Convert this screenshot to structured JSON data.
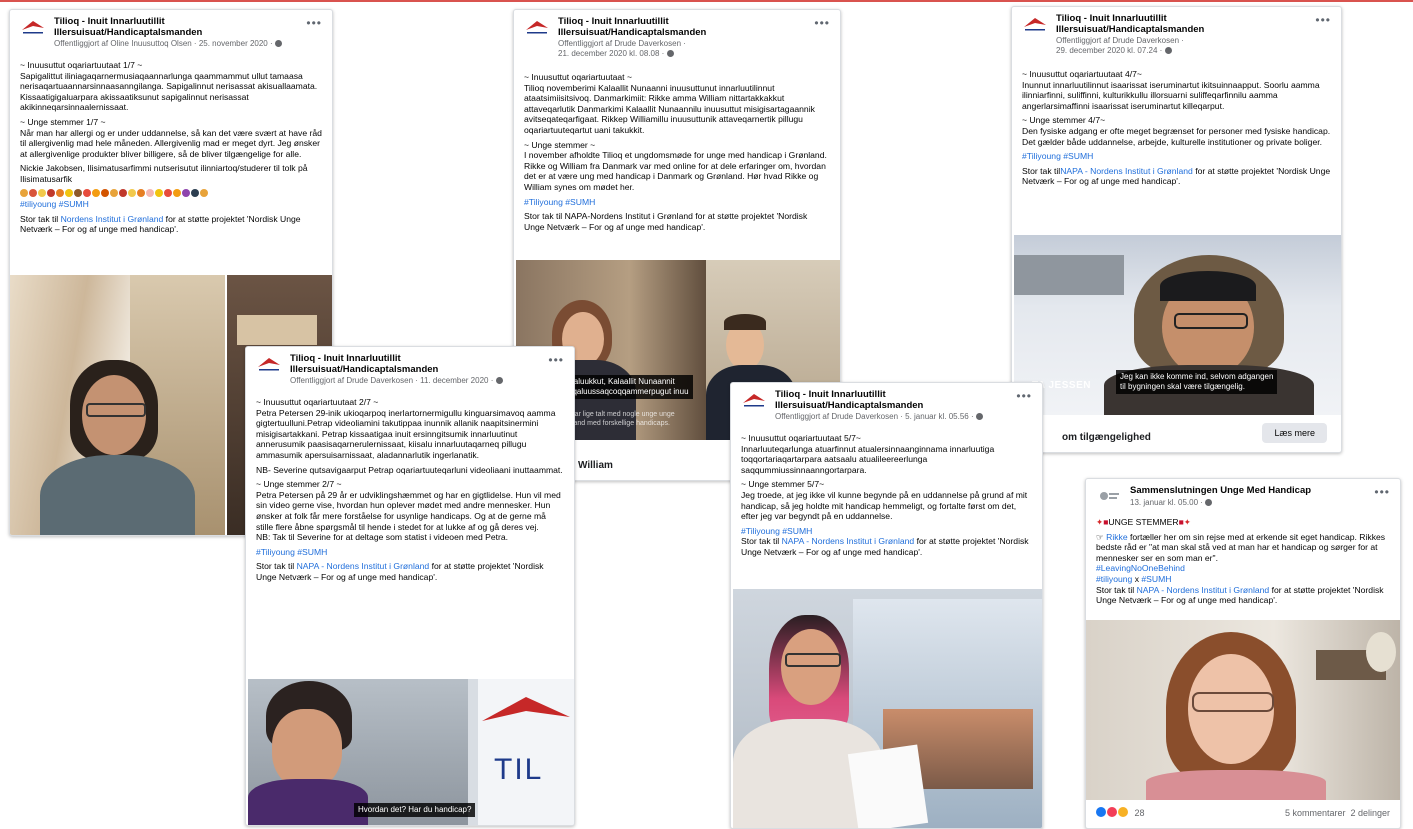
{
  "colors": {
    "accent_link": "#216fdb",
    "meta": "#65676b",
    "topline": "#d9534f"
  },
  "posts": {
    "p1": {
      "page": "Tilioq - Inuit Innarluutillit Illersuisuat/Handicaptalsmanden",
      "meta": "Offentliggjort af Oline Inuusuttoq Olsen · 25. november 2020 ·",
      "head_gl": "~ Inuusuttut oqariartuutaat 1/7 ~",
      "text_gl": "Sapigalittut iliniagaqarnermusiaqaannarlunga qaammammut ullut tamaasa nerisaqartuaannarsinnaasanngilanga. Sapigalinnut nerisassat akisuallaamata. Kissaatigigaluarpara akissaatiksunut sapigalinnut nerisassat akikinneqarsinnaalernissaat.",
      "head_da": "~ Unge stemmer 1/7 ~",
      "text_da": "Når man har allergi og er under uddannelse, så kan det være svært at have råd til allergivenlig mad hele måneden. Allergivenlig mad er meget dyrt. Jeg ønsker at allergivenlige produkter bliver billigere, så de bliver tilgængelige for alle.",
      "credit": "Nickie Jakobsen, Ilisimatusarfimmi nutserisutut ilinniartoq/studerer til tolk på Ilisimatusarfik",
      "tags": "#tiliyoung #SUMH",
      "thanks_pre": "Stor tak til ",
      "thanks_link": "Nordens Institut i Grønland",
      "thanks_post": " for at støtte projektet 'Nordisk Unge Netværk – For og af unge med handicap'."
    },
    "p2": {
      "page": "Tilioq - Inuit Innarluutillit Illersuisuat/Handicaptalsmanden",
      "meta": "Offentliggjort af Drude Daverkosen ·",
      "meta2": "21. december 2020 kl. 08.08 ·",
      "head_gl": "~ Inuusuttut oqariartuutaat ~",
      "text_gl": "Tilioq novemberimi Kalaallit Nunaanni inuusuttunut innarluutilinnut ataatsimiisitsivoq. Danmarkimiit: Rikke amma William nittartakkakkut attaveqarlutik Danmarkimi Kalaallit Nunaannilu inuusuttut misigisartagaannik avitseqateqarfigaat. Rikkep Williamillu inuusuttunik attaveqarnertik pillugu oqariartuuteqartut uani takukkit.",
      "head_da": "~ Unge stemmer ~",
      "text_da": "I november afholdte Tilioq et ungdomsmøde for unge med handicap i Grønland. Rikke og William fra Danmark var med online for at dele erfaringer om, hvordan det er at være ung med handicap i Danmark og Grønland. Hør hvad Rikke og William synes om mødet her.",
      "tags": "#Tiliyoung #SUMH",
      "thanks": "Stor tak til NAPA-Nordens Institut i Grønland for at støtte projektet 'Nordisk Unge Netværk – For og af unge med handicap'.",
      "caption1": "Haluukkut, Kalaallit Nunaannit",
      "caption2": "oqaluussaqcoqqammerpugut inuu",
      "caption3": "u, vi har lige talt med nogle unge unge",
      "caption4": "Grønland med forskellige handicaps.",
      "footer": "William"
    },
    "p3": {
      "page": "Tilioq - Inuit Innarluutillit Illersuisuat/Handicaptalsmanden",
      "meta": "Offentliggjort af Drude Daverkosen ·",
      "meta2": "29. december 2020 kl. 07.24 ·",
      "head_gl": "~ Inuusuttut oqariartuutaat 4/7~",
      "text_gl": "Inunnut innarluutilinnut isaarissat iseruminartut ikitsuinnaapput. Soorlu aamma ilinniarfinni, suliffinni, kulturikkullu illorsuarni suliffeqarfinnilu aamma angerlarsimaffinni isaarissat iseruminartut killeqarput.",
      "head_da": "~ Unge stemmer 4/7~",
      "text_da": "Den fysiske adgang er ofte meget begrænset for personer med fysiske handicap. Det gælder både uddannelse, arbejde, kulturelle institutioner og private boliger.",
      "tags": "#Tiliyoung #SUMH",
      "thanks_pre": "Stor tak til",
      "thanks_link": "NAPA - Nordens Institut i Grønland",
      "thanks_post": " for at støtte projektet 'Nordisk Unge Netværk – For og af unge med handicap'.",
      "caption1": "Jeg kan ikke komme ind, selvom adgangen",
      "caption2": "til bygningen skal være tilgængelig.",
      "name_overlay": "TA JESSEN",
      "footer": "om tilgængelighed",
      "read_more": "Læs mere"
    },
    "p4": {
      "page": "Tilioq - Inuit Innarluutillit Illersuisuat/Handicaptalsmanden",
      "meta": "Offentliggjort af Drude Daverkosen · 11. december 2020 ·",
      "head_gl": "~ Inuusuttut oqariartuutaat 2/7 ~",
      "text_gl": "Petra Petersen 29-inik ukioqarpoq inerlartornermigullu kinguarsimavoq aamma gigtertuulluni.Petrap videoliamini takutippaa inunnik allanik naapitsinermini misigisartakkani. Petrap kissaatigaa inuit ersinngitsumik innarluutinut annerusumik paasisaqarnerulernissaat, kiisalu innarluutaqarneq pillugu ammasumik apersuisarnissaat, aladannarlutik ingerlanatik.",
      "nb_gl": "NB- Severine qutsavigaarput Petrap oqariartuuteqarluni videoliaani inuttaammat.",
      "head_da": "~ Unge stemmer 2/7 ~",
      "text_da": "Petra Petersen på 29 år er udviklingshæmmet og har en gigtlidelse. Hun vil med sin video gerne vise, hvordan hun oplever mødet med andre mennesker. Hun ønsker at folk får mere forståelse for usynlige handicaps. Og at de gerne må stille flere åbne spørgsmål til hende i stedet for at lukke af og gå deres vej.",
      "nb_da": "NB: Tak til Severine for at deltage som statist i videoen med Petra.",
      "tags": "#Tiliyoung #SUMH",
      "thanks_pre": "Stor tak til ",
      "thanks_link": "NAPA - Nordens Institut i Grønland",
      "thanks_post": " for at støtte projektet 'Nordisk Unge Netværk – For og af unge med handicap'.",
      "caption": "Hvordan det? Har du handicap?",
      "banner": "TIL"
    },
    "p5": {
      "page": "Tilioq - Inuit Innarluutillit Illersuisuat/Handicaptalsmanden",
      "meta": "Offentliggjort af Drude Daverkosen · 5. januar kl. 05.56 ·",
      "head_gl": "~ Inuusuttut oqariartuutaat 5/7~",
      "text_gl": "Innarluuteqarlunga atuarfinnut atualersinnaanginnama innarluutiga toqqortariaqartarpara aatsaalu atualileereerlunga saqqummiussinnaanngortarpara.",
      "head_da": "~ Unge stemmer 5/7~",
      "text_da": "Jeg troede, at jeg ikke vil kunne begynde på en uddannelse på grund af mit handicap, så jeg holdte mit handicap hemmeligt, og  fortalte først om det, efter jeg var begyndt på en uddannelse.",
      "tags": "#Tiliyoung #SUMH",
      "thanks_pre": "Stor tak til ",
      "thanks_link": "NAPA - Nordens Institut i Grønland",
      "thanks_post": " for at støtte projektet 'Nordisk Unge Netværk – For og af unge med handicap'."
    },
    "p6": {
      "page": "Sammenslutningen Unge Med Handicap",
      "meta": "13. januar kl. 05.00 ·",
      "headline": "UNGE STEMMER",
      "mention": "Rikke",
      "text": " fortæller her om sin rejse med at erkende sit eget handicap. Rikkes bedste råd er \"at man skal stå ved at man har et handicap og sørger for at mennesker ser en som man er\".",
      "tag1": "#LeavingNoOneBehind",
      "tag2": "#tiliyoung",
      "tag_sep": " x ",
      "tag3": "#SUMH",
      "thanks_pre": "Stor tak til ",
      "thanks_link": "NAPA - Nordens Institut i Grønland",
      "thanks_post": " for at støtte projektet 'Nordisk Unge Netværk – For og af unge med handicap'.",
      "reactions": "28",
      "comments": "5 kommentarer  2 delinger"
    }
  },
  "more_glyph": "•••"
}
